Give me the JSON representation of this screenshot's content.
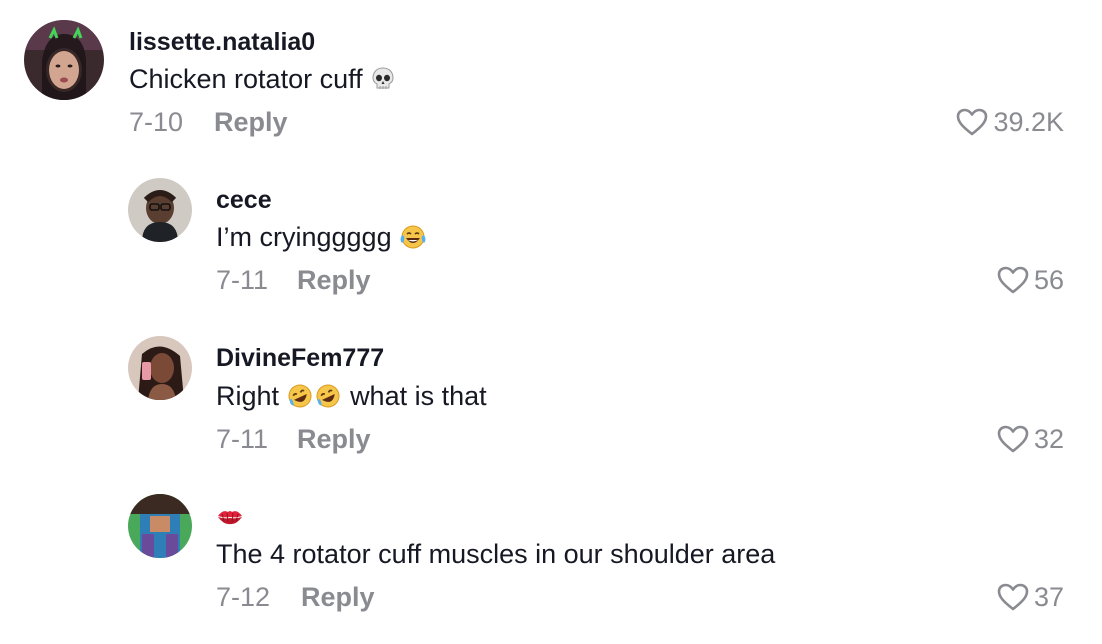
{
  "comments": [
    {
      "username": "lissette.natalia0",
      "text": "Chicken rotator cuff",
      "emoji": "skull",
      "date": "7-10",
      "reply_label": "Reply",
      "likes": "39.2K"
    },
    {
      "username": "cece",
      "text": "I’m cryinggggg",
      "emoji": "face-with-tears-of-joy",
      "date": "7-11",
      "reply_label": "Reply",
      "likes": "56"
    },
    {
      "username": "DivineFem777",
      "text_before": "Right",
      "text_after": "what is that",
      "emoji": "rolling-on-the-floor-laughing x2",
      "date": "7-11",
      "reply_label": "Reply",
      "likes": "32"
    },
    {
      "username_emoji": "kiss-mark",
      "text": "The 4 rotator cuff muscles in our shoulder area",
      "date": "7-12",
      "reply_label": "Reply",
      "likes": "37"
    }
  ],
  "colors": {
    "text": "#161823",
    "muted": "#8a8b91",
    "background": "#ffffff"
  }
}
